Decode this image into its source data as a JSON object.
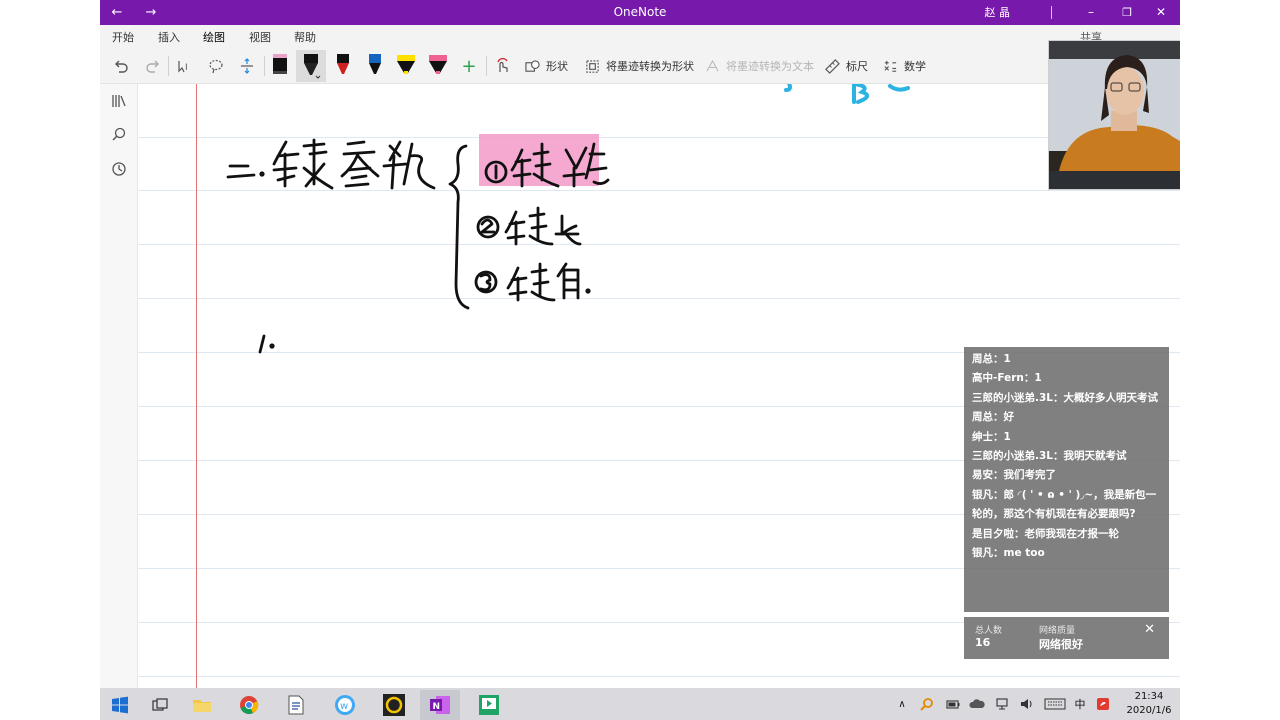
{
  "titlebar": {
    "back": "←",
    "forward": "→",
    "title": "OneNote",
    "user": "赵 晶",
    "minimize": "–",
    "maximize": "❐",
    "close": "✕"
  },
  "ribbon": {
    "tabs": [
      "开始",
      "插入",
      "绘图",
      "视图",
      "帮助"
    ],
    "active_tab": "绘图",
    "share_label": "共享"
  },
  "toolbar": {
    "shape_label": "形状",
    "ink_to_shape_label": "将墨迹转换为形状",
    "ink_to_text_label": "将墨迹转换为文本",
    "ruler_label": "标尺",
    "math_label": "数学",
    "pen_colors": [
      "#000000",
      "#111111",
      "#d01f1f",
      "#1565c0",
      "#ffe000",
      "#f06292"
    ]
  },
  "page": {
    "ink_color": "#111111",
    "highlight_color": "#f49ac8",
    "accent_ink_color": "#2ab3e3"
  },
  "chat": {
    "messages": [
      "周总：1",
      "高中-Fern：1",
      "三郎的小迷弟.3L：大概好多人明天考试",
      "周总：好",
      "绅士：1",
      "三郎的小迷弟.3L：我明天就考试",
      "易安：我们考完了",
      "银凡：郎 ◜( ' • ɷ • ' )◞~，我是新包一轮的，那这个有机现在有必要跟吗?",
      "是目夕啦：老师我现在才报一轮",
      "银凡：me too"
    ]
  },
  "stats": {
    "total_label": "总人数",
    "total_value": "16",
    "network_label": "网络质量",
    "network_value": "网络很好",
    "close": "✕"
  },
  "taskbar": {
    "ime": "中",
    "time": "21:34",
    "date": "2020/1/6"
  }
}
